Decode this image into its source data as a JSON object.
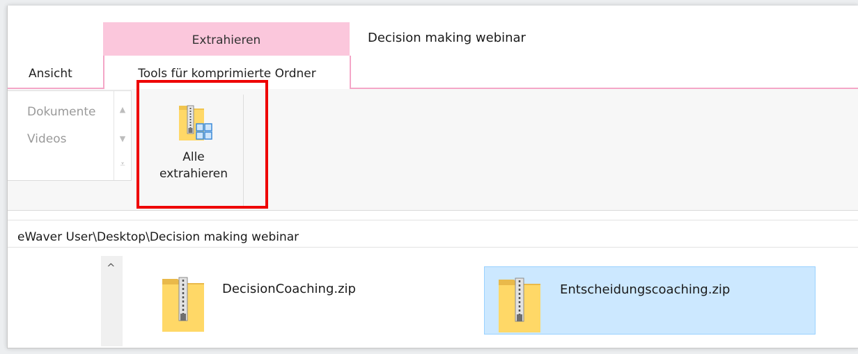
{
  "window": {
    "title": "Decision making webinar",
    "contextual_group": "Extrahieren"
  },
  "tabs": [
    {
      "label": "Ansicht",
      "active": false
    },
    {
      "label": "Tools für komprimierte Ordner",
      "active": true
    }
  ],
  "ribbon": {
    "gallery_items": [
      "Dokumente",
      "Videos"
    ],
    "extract_all": {
      "line1": "Alle",
      "line2": "extrahieren",
      "icon": "zip-folder-extract-icon"
    }
  },
  "address_bar": {
    "path": "eWaver User\\Desktop\\Decision making webinar"
  },
  "files": [
    {
      "name": "DecisionCoaching.zip",
      "icon": "zip-folder-icon",
      "selected": false
    },
    {
      "name": "Entscheidungscoaching.zip",
      "icon": "zip-folder-icon",
      "selected": true
    }
  ],
  "colors": {
    "contextual_tab": "#fbc7dc",
    "contextual_border": "#f4a6c7",
    "selection_bg": "#cce8ff",
    "selection_border": "#99d1ff",
    "highlight": "#ee0000"
  }
}
